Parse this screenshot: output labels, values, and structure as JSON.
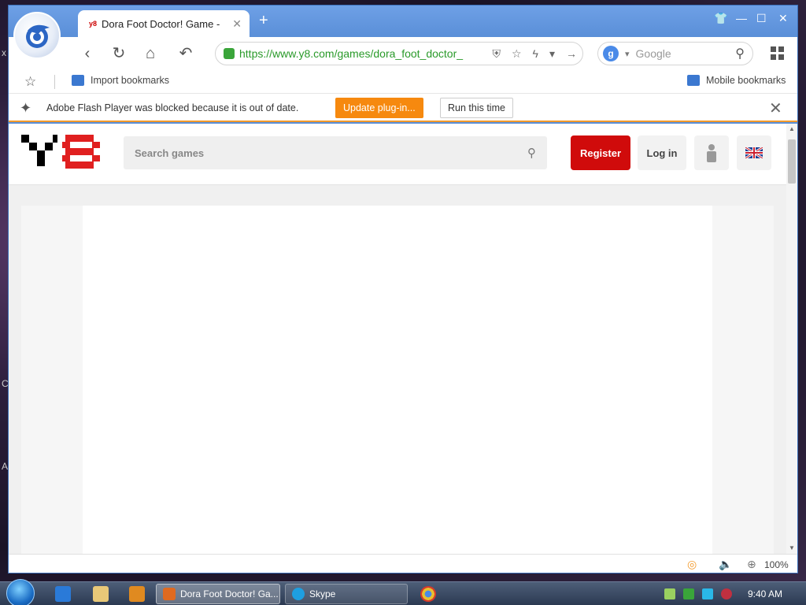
{
  "tab": {
    "title": "Dora Foot Doctor! Game -",
    "favicon": "y8"
  },
  "address": {
    "url": "https://www.y8.com/games/dora_foot_doctor_"
  },
  "search_engine": {
    "placeholder": "Google"
  },
  "bookmarks": {
    "import": "Import bookmarks",
    "mobile": "Mobile bookmarks"
  },
  "flash": {
    "message": "Adobe Flash Player was blocked because it is out of date.",
    "update_label": "Update plug-in...",
    "run_label": "Run this time"
  },
  "site": {
    "search_placeholder": "Search games",
    "register_label": "Register",
    "login_label": "Log in"
  },
  "status": {
    "zoom": "100%"
  },
  "taskbar": {
    "browser_task": "Dora Foot Doctor! Ga...",
    "skype_task": "Skype",
    "clock": "9:40 AM"
  },
  "colors": {
    "accent_blue": "#5a8fd8",
    "flash_orange": "#f6890f",
    "register_red": "#d00b0b",
    "url_green": "#2a9a2a"
  }
}
